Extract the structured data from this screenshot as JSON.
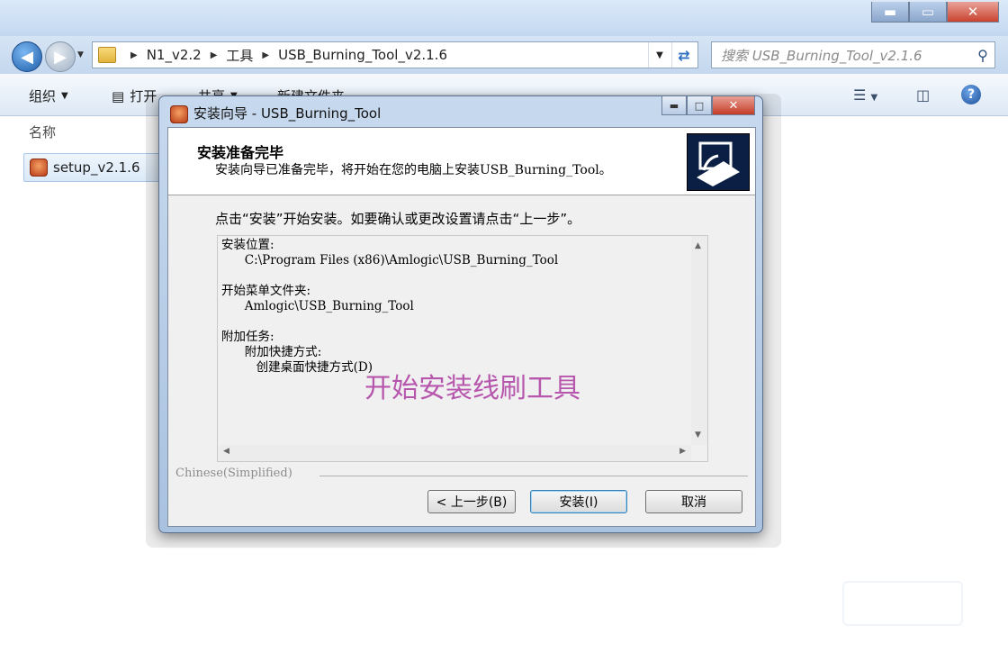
{
  "explorer": {
    "window_buttons": {
      "minimize": "▬",
      "maximize": "▭",
      "close": "✕"
    },
    "breadcrumbs": [
      "N1_v2.2",
      "工具",
      "USB_Burning_Tool_v2.1.6"
    ],
    "search_placeholder": "搜索 USB_Burning_Tool_v2.1.6",
    "toolbar": {
      "organize": "组织",
      "open": "打开",
      "share": "共享",
      "new_folder": "新建文件夹"
    },
    "column_header": "名称",
    "files": [
      {
        "name": "setup_v2.1.6",
        "icon": "app-icon"
      }
    ]
  },
  "dialog": {
    "title": "安装向导 - USB_Burning_Tool",
    "header_title": "安装准备完毕",
    "header_subtitle": "安装向导已准备完毕，将开始在您的电脑上安装USB_Burning_Tool。",
    "instruction": "点击“安装”开始安装。如要确认或更改设置请点击“上一步”。",
    "memo": "安装位置:\n      C:\\Program Files (x86)\\Amlogic\\USB_Burning_Tool\n\n开始菜单文件夹:\n      Amlogic\\USB_Burning_Tool\n\n附加任务:\n      附加快捷方式:\n         创建桌面快捷方式(D)",
    "overlay_text": "开始安装线刷工具",
    "language": "Chinese(Simplified)",
    "buttons": {
      "back": "< 上一步(B)",
      "install": "安装(I)",
      "cancel": "取消"
    },
    "colors": {
      "overlay": "#b24aa8",
      "header_image": "#0b1f45"
    }
  }
}
